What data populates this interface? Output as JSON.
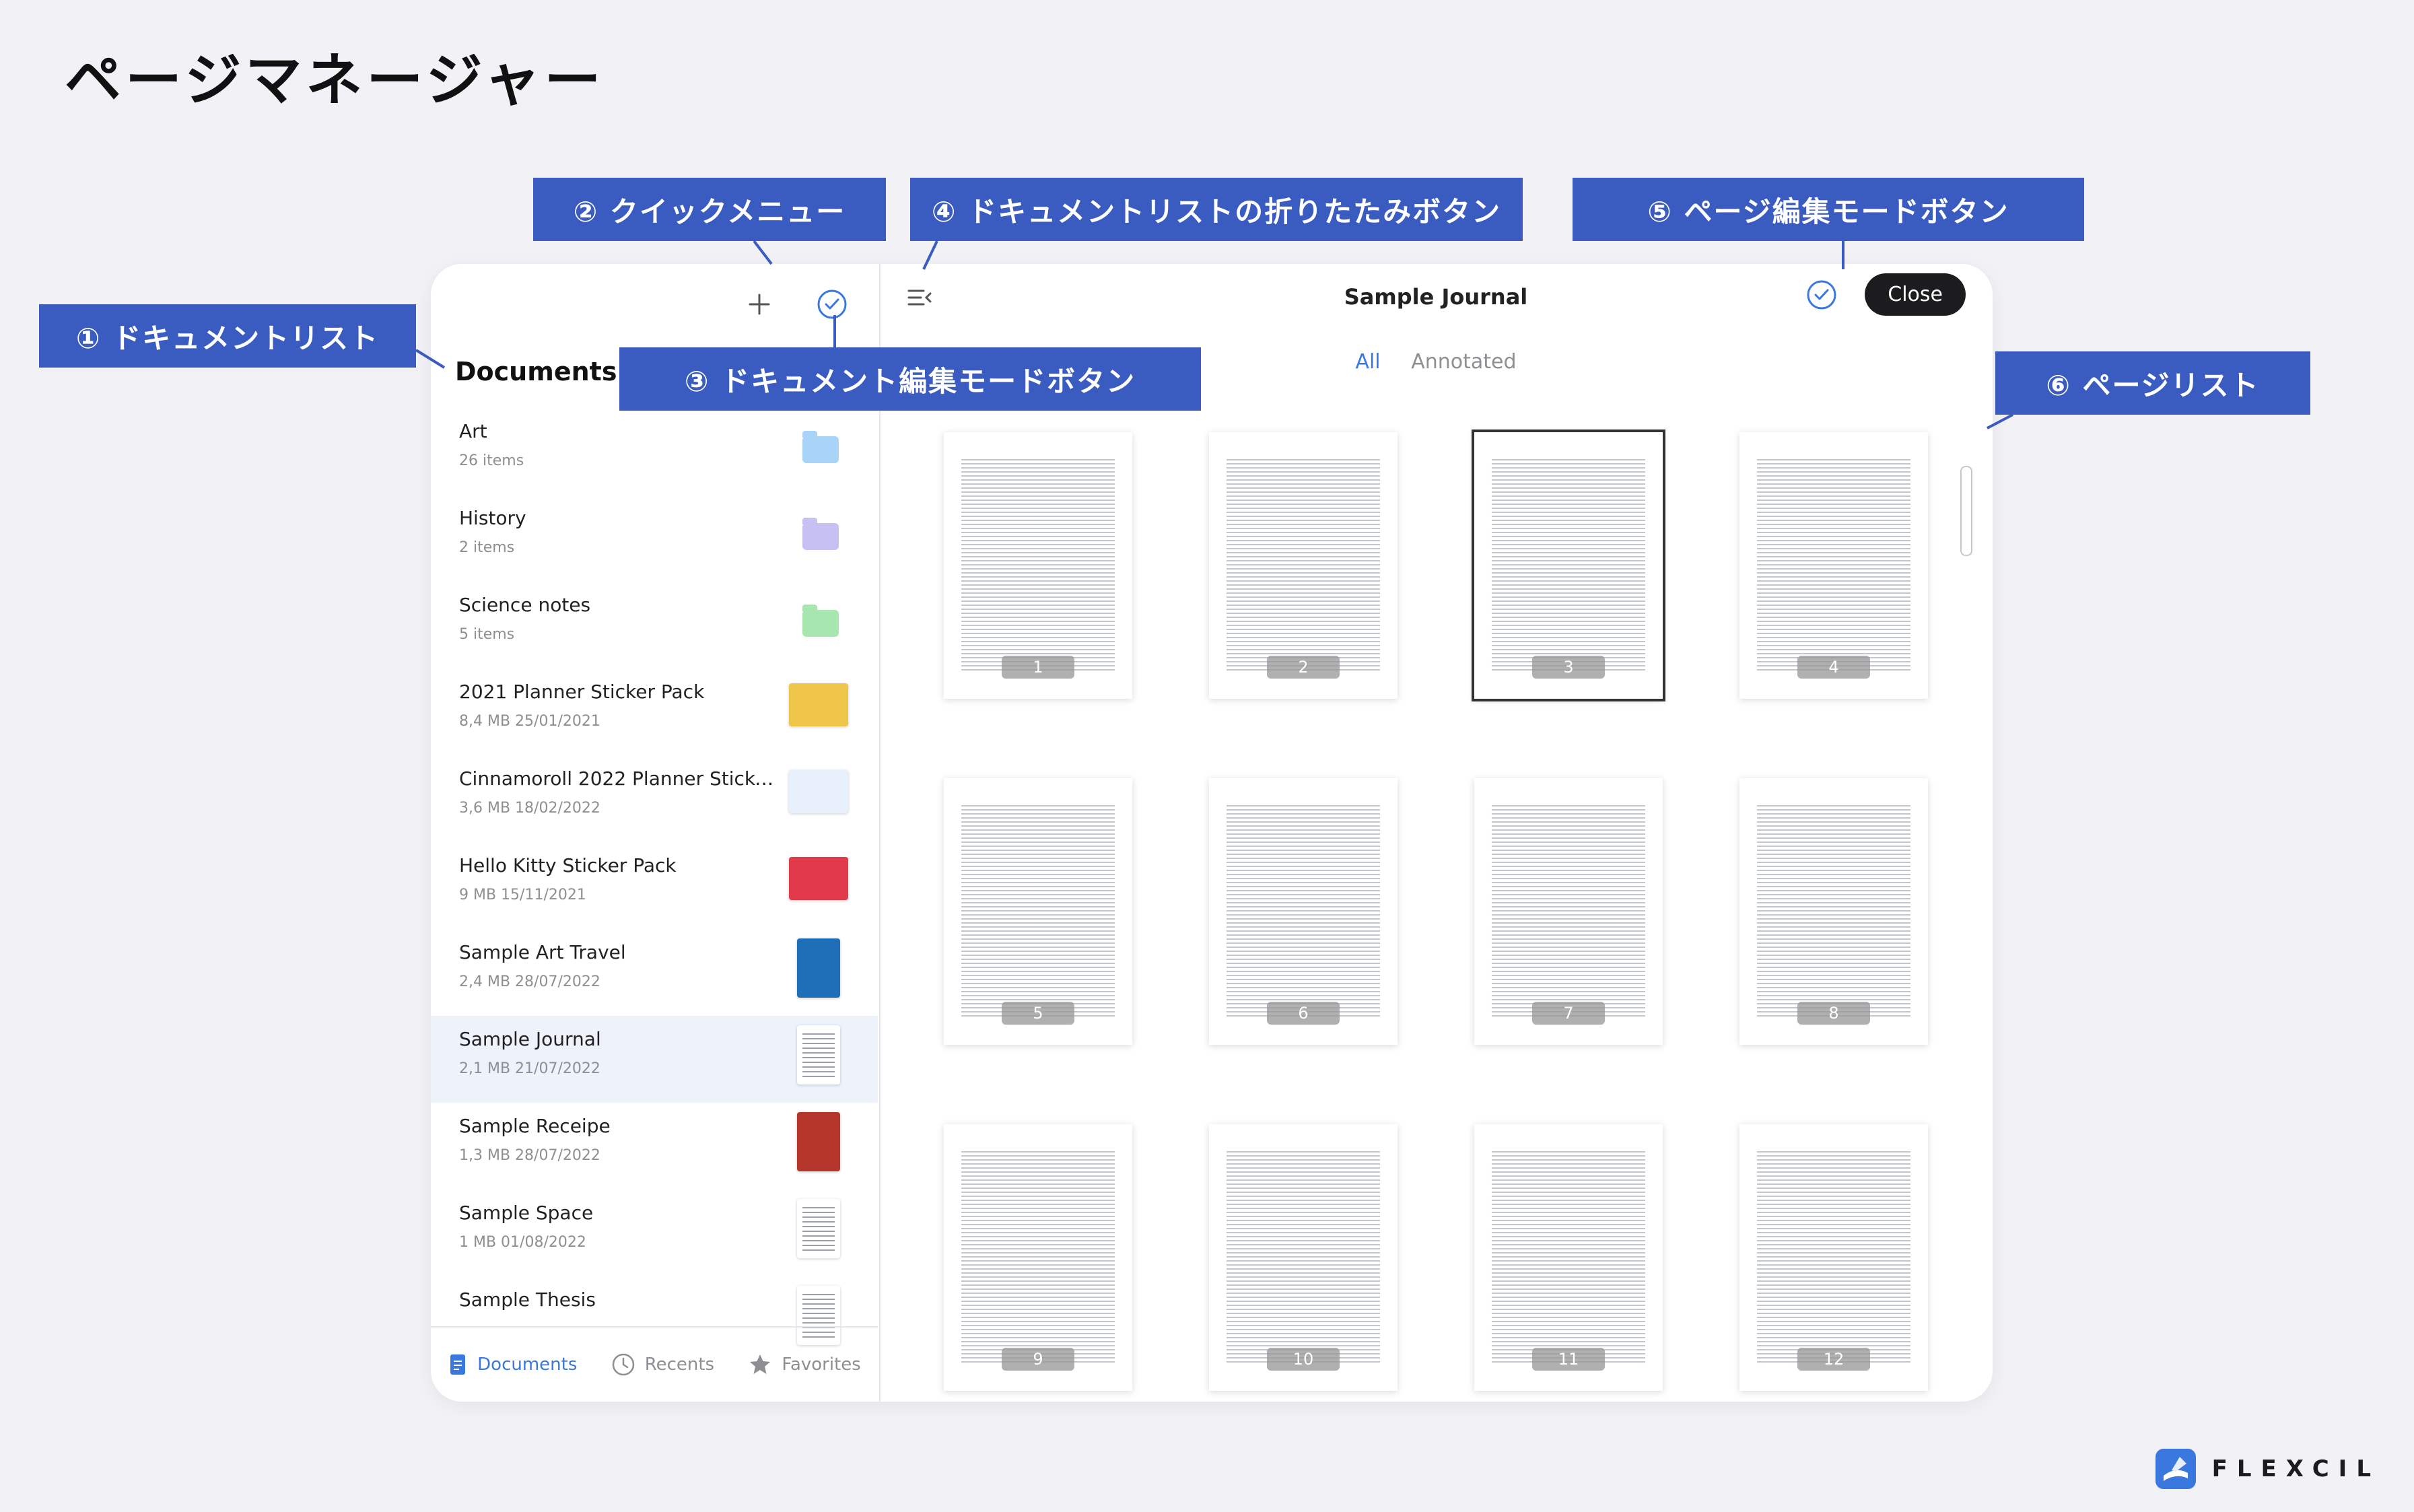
{
  "page_title": "ページマネージャー",
  "callouts": {
    "c1": "① ドキュメントリスト",
    "c2": "② クイックメニュー",
    "c3": "③ ドキュメント編集モードボタン",
    "c4": "④ ドキュメントリストの折りたたみボタン",
    "c5": "⑤ ページ編集モードボタン",
    "c6": "⑥ ページリスト"
  },
  "sidebar": {
    "heading": "Documents",
    "items": [
      {
        "name": "Art",
        "meta": "26 items",
        "kind": "folder",
        "color": "#a9d3f7"
      },
      {
        "name": "History",
        "meta": "2 items",
        "kind": "folder",
        "color": "#c7c0f2"
      },
      {
        "name": "Science notes",
        "meta": "5 items",
        "kind": "folder",
        "color": "#a8e6b0"
      },
      {
        "name": "2021 Planner Sticker Pack",
        "meta": "8,4 MB 25/01/2021",
        "kind": "thumb",
        "color": "#f0c64a"
      },
      {
        "name": "Cinnamoroll 2022 Planner Sticker...",
        "meta": "3,6 MB 18/02/2022",
        "kind": "thumb",
        "color": "#e8f1fb"
      },
      {
        "name": "Hello Kitty Sticker Pack",
        "meta": "9 MB 15/11/2021",
        "kind": "thumb",
        "color": "#e23a4a"
      },
      {
        "name": "Sample Art Travel",
        "meta": "2,4 MB 28/07/2022",
        "kind": "portrait",
        "color": "#1f6fb8"
      },
      {
        "name": "Sample Journal",
        "meta": "2,1 MB 21/07/2022",
        "kind": "paper",
        "color": "#ffffff"
      },
      {
        "name": "Sample Receipe",
        "meta": "1,3 MB 28/07/2022",
        "kind": "portrait",
        "color": "#b5372c"
      },
      {
        "name": "Sample Space",
        "meta": "1 MB 01/08/2022",
        "kind": "paper",
        "color": "#ffffff"
      },
      {
        "name": "Sample Thesis",
        "meta": "",
        "kind": "paper",
        "color": "#ffffff"
      }
    ],
    "selected_index": 7
  },
  "tabbar": {
    "documents": "Documents",
    "recents": "Recents",
    "favorites": "Favorites"
  },
  "main": {
    "title": "Sample Journal",
    "close_label": "Close",
    "filter_all": "All",
    "filter_annotated": "Annotated",
    "pages": [
      "1",
      "2",
      "3",
      "4",
      "5",
      "6",
      "7",
      "8",
      "9",
      "10",
      "11",
      "12"
    ],
    "selected_page": 3
  },
  "brand": "FLEXCIL",
  "colors": {
    "accent": "#3a78e0",
    "callout": "#3a5bbf",
    "close_button": "#1c1c1e"
  }
}
